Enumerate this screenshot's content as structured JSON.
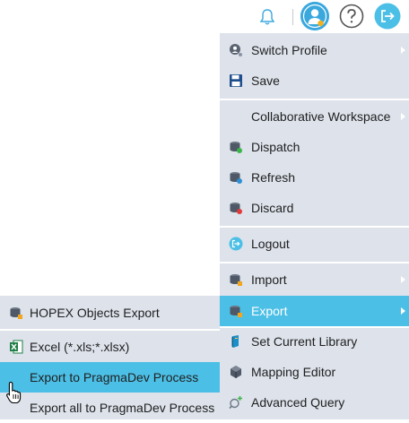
{
  "topbar": {
    "icons": [
      "bell-icon",
      "user-avatar-icon",
      "help-icon",
      "logout-icon"
    ]
  },
  "menu": {
    "items": [
      {
        "label": "Switch Profile",
        "icon": "switch-profile-icon",
        "has_submenu": true
      },
      {
        "label": "Save",
        "icon": "save-icon",
        "has_submenu": false
      },
      {
        "label": "Collaborative Workspace",
        "icon": "",
        "has_submenu": true
      },
      {
        "label": "Dispatch",
        "icon": "dispatch-icon",
        "has_submenu": false
      },
      {
        "label": "Refresh",
        "icon": "refresh-icon",
        "has_submenu": false
      },
      {
        "label": "Discard",
        "icon": "discard-icon",
        "has_submenu": false
      },
      {
        "label": "Logout",
        "icon": "logout-icon",
        "has_submenu": false
      },
      {
        "label": "Import",
        "icon": "import-icon",
        "has_submenu": true
      },
      {
        "label": "Export",
        "icon": "export-icon",
        "has_submenu": true,
        "active": true
      },
      {
        "label": "Set Current Library",
        "icon": "library-icon",
        "has_submenu": false
      },
      {
        "label": "Mapping Editor",
        "icon": "mapping-editor-icon",
        "has_submenu": false
      },
      {
        "label": "Advanced Query",
        "icon": "advanced-query-icon",
        "has_submenu": false
      }
    ]
  },
  "submenu": {
    "items": [
      {
        "label": "HOPEX Objects Export",
        "icon": "hopex-export-icon"
      },
      {
        "label": "Excel (*.xls;*.xlsx)",
        "icon": "excel-icon"
      },
      {
        "label": "Export to PragmaDev Process",
        "icon": "",
        "active": true
      },
      {
        "label": "Export all to PragmaDev Process",
        "icon": ""
      }
    ]
  },
  "colors": {
    "menu_bg": "#dde2eb",
    "active_bg": "#4cbfe6",
    "accent": "#3aa8dd"
  }
}
